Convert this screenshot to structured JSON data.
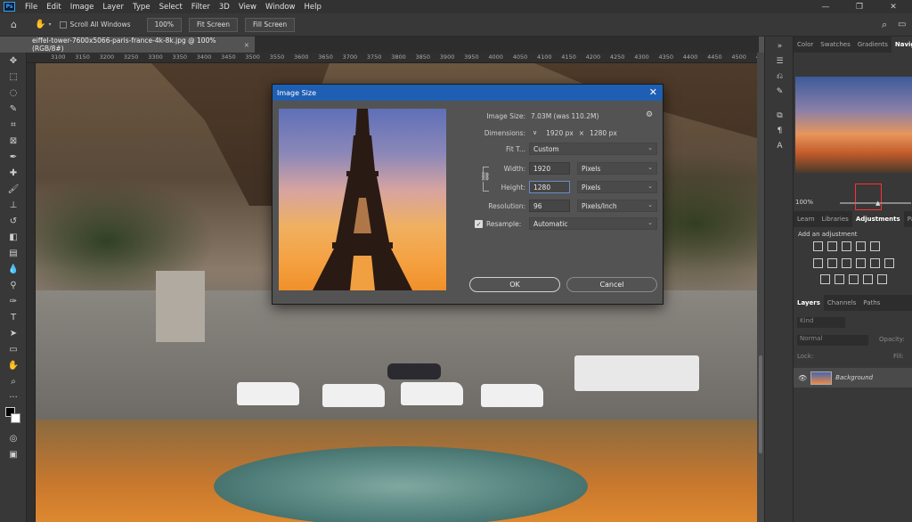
{
  "menubar": {
    "logo": "Ps",
    "items": [
      "File",
      "Edit",
      "Image",
      "Layer",
      "Type",
      "Select",
      "Filter",
      "3D",
      "View",
      "Window",
      "Help"
    ]
  },
  "options_bar": {
    "scroll_all_windows": "Scroll All Windows",
    "zoom_100": "100%",
    "fit_screen": "Fit Screen",
    "fill_screen": "Fill Screen"
  },
  "document_tab": {
    "title": "eiffel-tower-7600x5066-paris-france-4k-8k.jpg @ 100% (RGB/8#)",
    "close": "×"
  },
  "ruler_ticks": [
    "3100",
    "3150",
    "3200",
    "3250",
    "3300",
    "3350",
    "3400",
    "3450",
    "3500",
    "3550",
    "3600",
    "3650",
    "3700",
    "3750",
    "3800",
    "3850",
    "3900",
    "3950",
    "4000",
    "4050",
    "4100",
    "4150",
    "4200",
    "4250",
    "4300",
    "4350",
    "4400",
    "4450",
    "4500",
    "4550"
  ],
  "right_panel": {
    "top_tabs": [
      "Color",
      "Swatches",
      "Gradients",
      "Navigat"
    ],
    "zoom": "100%",
    "mid_tabs": [
      "Learn",
      "Libraries",
      "Adjustments",
      "Patt"
    ],
    "add_adjustment": "Add an adjustment",
    "layer_tabs": [
      "Layers",
      "Channels",
      "Paths"
    ],
    "kind": "Kind",
    "blend_mode": "Normal",
    "opacity": "Opacity:",
    "lock": "Lock:",
    "fill": "Fill:",
    "layer_name": "Background"
  },
  "dialog": {
    "title": "Image Size",
    "close": "✕",
    "image_size_label": "Image Size:",
    "image_size_value": "7.03M (was 110.2M)",
    "dimensions_label": "Dimensions:",
    "dim_width": "1920 px",
    "dim_x": "×",
    "dim_height": "1280 px",
    "fit_label": "Fit T...",
    "fit_value": "Custom",
    "width_label": "Width:",
    "width_value": "1920",
    "width_unit": "Pixels",
    "height_label": "Height:",
    "height_value": "1280",
    "height_unit": "Pixels",
    "resolution_label": "Resolution:",
    "resolution_value": "96",
    "resolution_unit": "Pixels/Inch",
    "resample_label": "Resample:",
    "resample_value": "Automatic",
    "ok": "OK",
    "cancel": "Cancel"
  }
}
